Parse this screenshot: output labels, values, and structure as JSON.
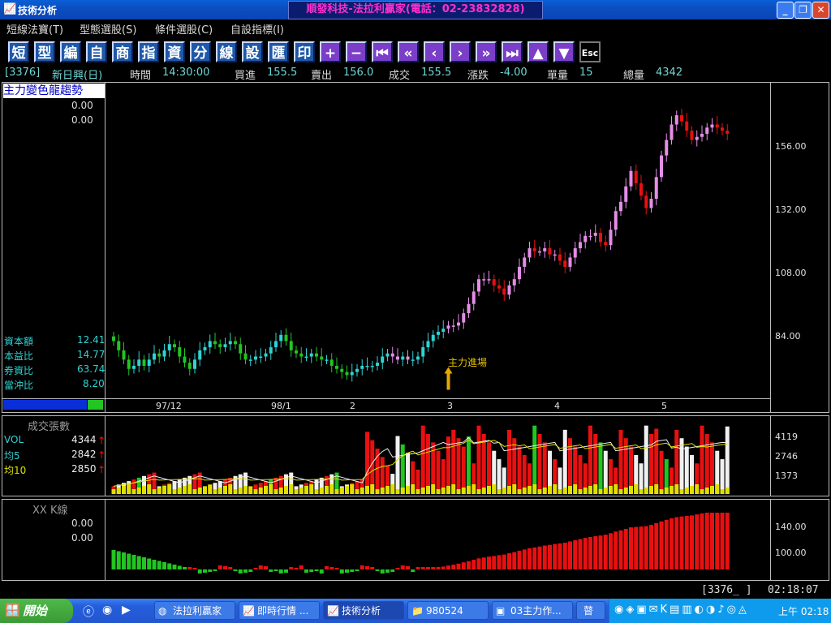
{
  "window": {
    "title": "技術分析",
    "banner": "順發科技-法拉利贏家(電話：02-23832828)",
    "min_label": "_",
    "max_label": "❐",
    "close_label": "✕"
  },
  "menu": [
    "短線法寶(T)",
    "型態選股(S)",
    "條件選股(C)",
    "自設指標(I)"
  ],
  "toolbar": [
    {
      "name": "short-button",
      "label": "短"
    },
    {
      "name": "pattern-button",
      "label": "型"
    },
    {
      "name": "edit-button",
      "label": "編"
    },
    {
      "name": "custom-button",
      "label": "自"
    },
    {
      "name": "product-button",
      "label": "商"
    },
    {
      "name": "index-button",
      "label": "指"
    },
    {
      "name": "data-button",
      "label": "資"
    },
    {
      "name": "minute-button",
      "label": "分"
    },
    {
      "name": "line-button",
      "label": "線"
    },
    {
      "name": "settings-button",
      "label": "設"
    },
    {
      "name": "export-button",
      "label": "匯"
    },
    {
      "name": "print-button",
      "label": "印"
    },
    {
      "name": "zoom-in-button",
      "label": "+"
    },
    {
      "name": "zoom-out-button",
      "label": "−"
    },
    {
      "name": "first-button",
      "label": "⏮"
    },
    {
      "name": "fast-back-button",
      "label": "«"
    },
    {
      "name": "back-button",
      "label": "‹"
    },
    {
      "name": "forward-button",
      "label": "›"
    },
    {
      "name": "fast-forward-button",
      "label": "»"
    },
    {
      "name": "last-button",
      "label": "⏭"
    },
    {
      "name": "up-button",
      "label": "▲"
    },
    {
      "name": "down-button",
      "label": "▼"
    },
    {
      "name": "esc-button",
      "label": "Esc"
    }
  ],
  "quote": {
    "code": "[3376]",
    "name": "新日興(日)",
    "time_label": "時間",
    "time": "14:30:00",
    "bid_label": "買進",
    "bid": "155.5",
    "ask_label": "賣出",
    "ask": "156.0",
    "last_label": "成交",
    "last": "155.5",
    "change_label": "漲跌",
    "change": "-4.00",
    "vol_label": "單量",
    "vol": "15",
    "total_label": "總量",
    "total": "4342"
  },
  "main_panel": {
    "title": "主力變色龍趨勢",
    "val1": "0.00",
    "val2": "0.00",
    "stats": [
      {
        "label": "資本額",
        "value": "12.41"
      },
      {
        "label": "本益比",
        "value": "14.77"
      },
      {
        "label": "券資比",
        "value": "63.74"
      },
      {
        "label": "當沖比",
        "value": "8.20"
      }
    ],
    "y_ticks": [
      "156.00",
      "132.00",
      "108.00",
      "84.00"
    ],
    "x_ticks": [
      "97/12",
      "98/1",
      "2",
      "3",
      "4",
      "5"
    ],
    "annotation": "主力進場"
  },
  "volume_panel": {
    "title": "成交張數",
    "rows": [
      {
        "label": "VOL",
        "value": "4344"
      },
      {
        "label": "均5",
        "value": "2842"
      },
      {
        "label": "均10",
        "value": "2850"
      }
    ],
    "y_ticks": [
      "4119",
      "2746",
      "1373"
    ]
  },
  "osc_panel": {
    "title": "XX K線",
    "val1": "0.00",
    "val2": "0.00",
    "y_ticks": [
      "140.00",
      "100.00"
    ]
  },
  "status": {
    "code": "[3376_ ]",
    "time": "02:18:07"
  },
  "taskbar": {
    "start": "開始",
    "tasks": [
      "法拉利贏家",
      "即時行情 ...",
      "技術分析",
      "980524",
      "03主力作...",
      "瞽"
    ],
    "clock": "上午 02:18"
  },
  "chart_data": {
    "type": "candlestick",
    "y_range": [
      70,
      172
    ],
    "x_labels": [
      "97/12",
      "98/1",
      "2",
      "3",
      "4",
      "5"
    ],
    "close": [
      88.5,
      85.5,
      82.5,
      79.5,
      80.5,
      82.5,
      80.5,
      82.5,
      84.5,
      83.5,
      85.5,
      87.5,
      86.5,
      83.5,
      81.5,
      79.5,
      82.5,
      85.5,
      86.5,
      88.5,
      87.5,
      86.5,
      87.5,
      88.5,
      87.5,
      84.5,
      82.5,
      82.5,
      83.5,
      83.5,
      84.5,
      86.5,
      88.5,
      90.5,
      88.5,
      85.5,
      84.5,
      83.5,
      83.5,
      84.5,
      83.5,
      82.5,
      82.5,
      80.5,
      79.5,
      78.5,
      77.5,
      78.5,
      79.5,
      80.5,
      80.5,
      80.5,
      81.5,
      83.5,
      84.5,
      83.5,
      82.5,
      83.5,
      82.5,
      82.5,
      83.5,
      86.5,
      88.5,
      90.5,
      91.5,
      92.5,
      93.5,
      93.5,
      94.5,
      97.5,
      100.5,
      104.5,
      108.5,
      108.5,
      108.5,
      106.5,
      105.5,
      103.5,
      106.5,
      108.5,
      112.5,
      115.5,
      118.5,
      117.5,
      117.5,
      118.5,
      116.5,
      116.5,
      114.5,
      112.5,
      115.5,
      118.5,
      120.5,
      122.5,
      122.5,
      123.5,
      120.5,
      119.5,
      124.5,
      130.5,
      133.5,
      138.5,
      143.5,
      139.5,
      135.5,
      131.5,
      134.5,
      141.5,
      148.5,
      153.5,
      158.5,
      161.5,
      159.5,
      156.5,
      153.5,
      154.5,
      155.5,
      157.5,
      158.5,
      157.5,
      156.5,
      155.5
    ],
    "volume_series": [
      {
        "name": "VOL",
        "last": 4344
      },
      {
        "name": "均5",
        "last": 2842
      },
      {
        "name": "均10",
        "last": 2850
      }
    ],
    "volume_y_ticks": [
      4119,
      2746,
      1373
    ],
    "osc_y_ticks": [
      140,
      100
    ]
  },
  "colors": {
    "up": "#e48ee8",
    "down_cyan": "#2fd3d3",
    "red": "#e81010",
    "green": "#22c522",
    "white": "#f0f0f0",
    "yellow": "#e0e000",
    "arrow": "#e6a800"
  }
}
